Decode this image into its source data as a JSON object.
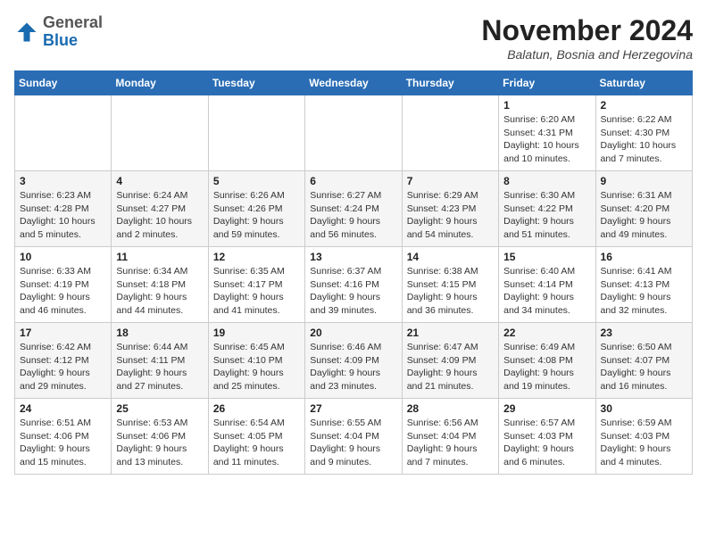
{
  "header": {
    "logo_general": "General",
    "logo_blue": "Blue",
    "month_title": "November 2024",
    "location": "Balatun, Bosnia and Herzegovina"
  },
  "weekdays": [
    "Sunday",
    "Monday",
    "Tuesday",
    "Wednesday",
    "Thursday",
    "Friday",
    "Saturday"
  ],
  "weeks": [
    [
      {
        "day": "",
        "info": ""
      },
      {
        "day": "",
        "info": ""
      },
      {
        "day": "",
        "info": ""
      },
      {
        "day": "",
        "info": ""
      },
      {
        "day": "",
        "info": ""
      },
      {
        "day": "1",
        "info": "Sunrise: 6:20 AM\nSunset: 4:31 PM\nDaylight: 10 hours and 10 minutes."
      },
      {
        "day": "2",
        "info": "Sunrise: 6:22 AM\nSunset: 4:30 PM\nDaylight: 10 hours and 7 minutes."
      }
    ],
    [
      {
        "day": "3",
        "info": "Sunrise: 6:23 AM\nSunset: 4:28 PM\nDaylight: 10 hours and 5 minutes."
      },
      {
        "day": "4",
        "info": "Sunrise: 6:24 AM\nSunset: 4:27 PM\nDaylight: 10 hours and 2 minutes."
      },
      {
        "day": "5",
        "info": "Sunrise: 6:26 AM\nSunset: 4:26 PM\nDaylight: 9 hours and 59 minutes."
      },
      {
        "day": "6",
        "info": "Sunrise: 6:27 AM\nSunset: 4:24 PM\nDaylight: 9 hours and 56 minutes."
      },
      {
        "day": "7",
        "info": "Sunrise: 6:29 AM\nSunset: 4:23 PM\nDaylight: 9 hours and 54 minutes."
      },
      {
        "day": "8",
        "info": "Sunrise: 6:30 AM\nSunset: 4:22 PM\nDaylight: 9 hours and 51 minutes."
      },
      {
        "day": "9",
        "info": "Sunrise: 6:31 AM\nSunset: 4:20 PM\nDaylight: 9 hours and 49 minutes."
      }
    ],
    [
      {
        "day": "10",
        "info": "Sunrise: 6:33 AM\nSunset: 4:19 PM\nDaylight: 9 hours and 46 minutes."
      },
      {
        "day": "11",
        "info": "Sunrise: 6:34 AM\nSunset: 4:18 PM\nDaylight: 9 hours and 44 minutes."
      },
      {
        "day": "12",
        "info": "Sunrise: 6:35 AM\nSunset: 4:17 PM\nDaylight: 9 hours and 41 minutes."
      },
      {
        "day": "13",
        "info": "Sunrise: 6:37 AM\nSunset: 4:16 PM\nDaylight: 9 hours and 39 minutes."
      },
      {
        "day": "14",
        "info": "Sunrise: 6:38 AM\nSunset: 4:15 PM\nDaylight: 9 hours and 36 minutes."
      },
      {
        "day": "15",
        "info": "Sunrise: 6:40 AM\nSunset: 4:14 PM\nDaylight: 9 hours and 34 minutes."
      },
      {
        "day": "16",
        "info": "Sunrise: 6:41 AM\nSunset: 4:13 PM\nDaylight: 9 hours and 32 minutes."
      }
    ],
    [
      {
        "day": "17",
        "info": "Sunrise: 6:42 AM\nSunset: 4:12 PM\nDaylight: 9 hours and 29 minutes."
      },
      {
        "day": "18",
        "info": "Sunrise: 6:44 AM\nSunset: 4:11 PM\nDaylight: 9 hours and 27 minutes."
      },
      {
        "day": "19",
        "info": "Sunrise: 6:45 AM\nSunset: 4:10 PM\nDaylight: 9 hours and 25 minutes."
      },
      {
        "day": "20",
        "info": "Sunrise: 6:46 AM\nSunset: 4:09 PM\nDaylight: 9 hours and 23 minutes."
      },
      {
        "day": "21",
        "info": "Sunrise: 6:47 AM\nSunset: 4:09 PM\nDaylight: 9 hours and 21 minutes."
      },
      {
        "day": "22",
        "info": "Sunrise: 6:49 AM\nSunset: 4:08 PM\nDaylight: 9 hours and 19 minutes."
      },
      {
        "day": "23",
        "info": "Sunrise: 6:50 AM\nSunset: 4:07 PM\nDaylight: 9 hours and 16 minutes."
      }
    ],
    [
      {
        "day": "24",
        "info": "Sunrise: 6:51 AM\nSunset: 4:06 PM\nDaylight: 9 hours and 15 minutes."
      },
      {
        "day": "25",
        "info": "Sunrise: 6:53 AM\nSunset: 4:06 PM\nDaylight: 9 hours and 13 minutes."
      },
      {
        "day": "26",
        "info": "Sunrise: 6:54 AM\nSunset: 4:05 PM\nDaylight: 9 hours and 11 minutes."
      },
      {
        "day": "27",
        "info": "Sunrise: 6:55 AM\nSunset: 4:04 PM\nDaylight: 9 hours and 9 minutes."
      },
      {
        "day": "28",
        "info": "Sunrise: 6:56 AM\nSunset: 4:04 PM\nDaylight: 9 hours and 7 minutes."
      },
      {
        "day": "29",
        "info": "Sunrise: 6:57 AM\nSunset: 4:03 PM\nDaylight: 9 hours and 6 minutes."
      },
      {
        "day": "30",
        "info": "Sunrise: 6:59 AM\nSunset: 4:03 PM\nDaylight: 9 hours and 4 minutes."
      }
    ]
  ]
}
